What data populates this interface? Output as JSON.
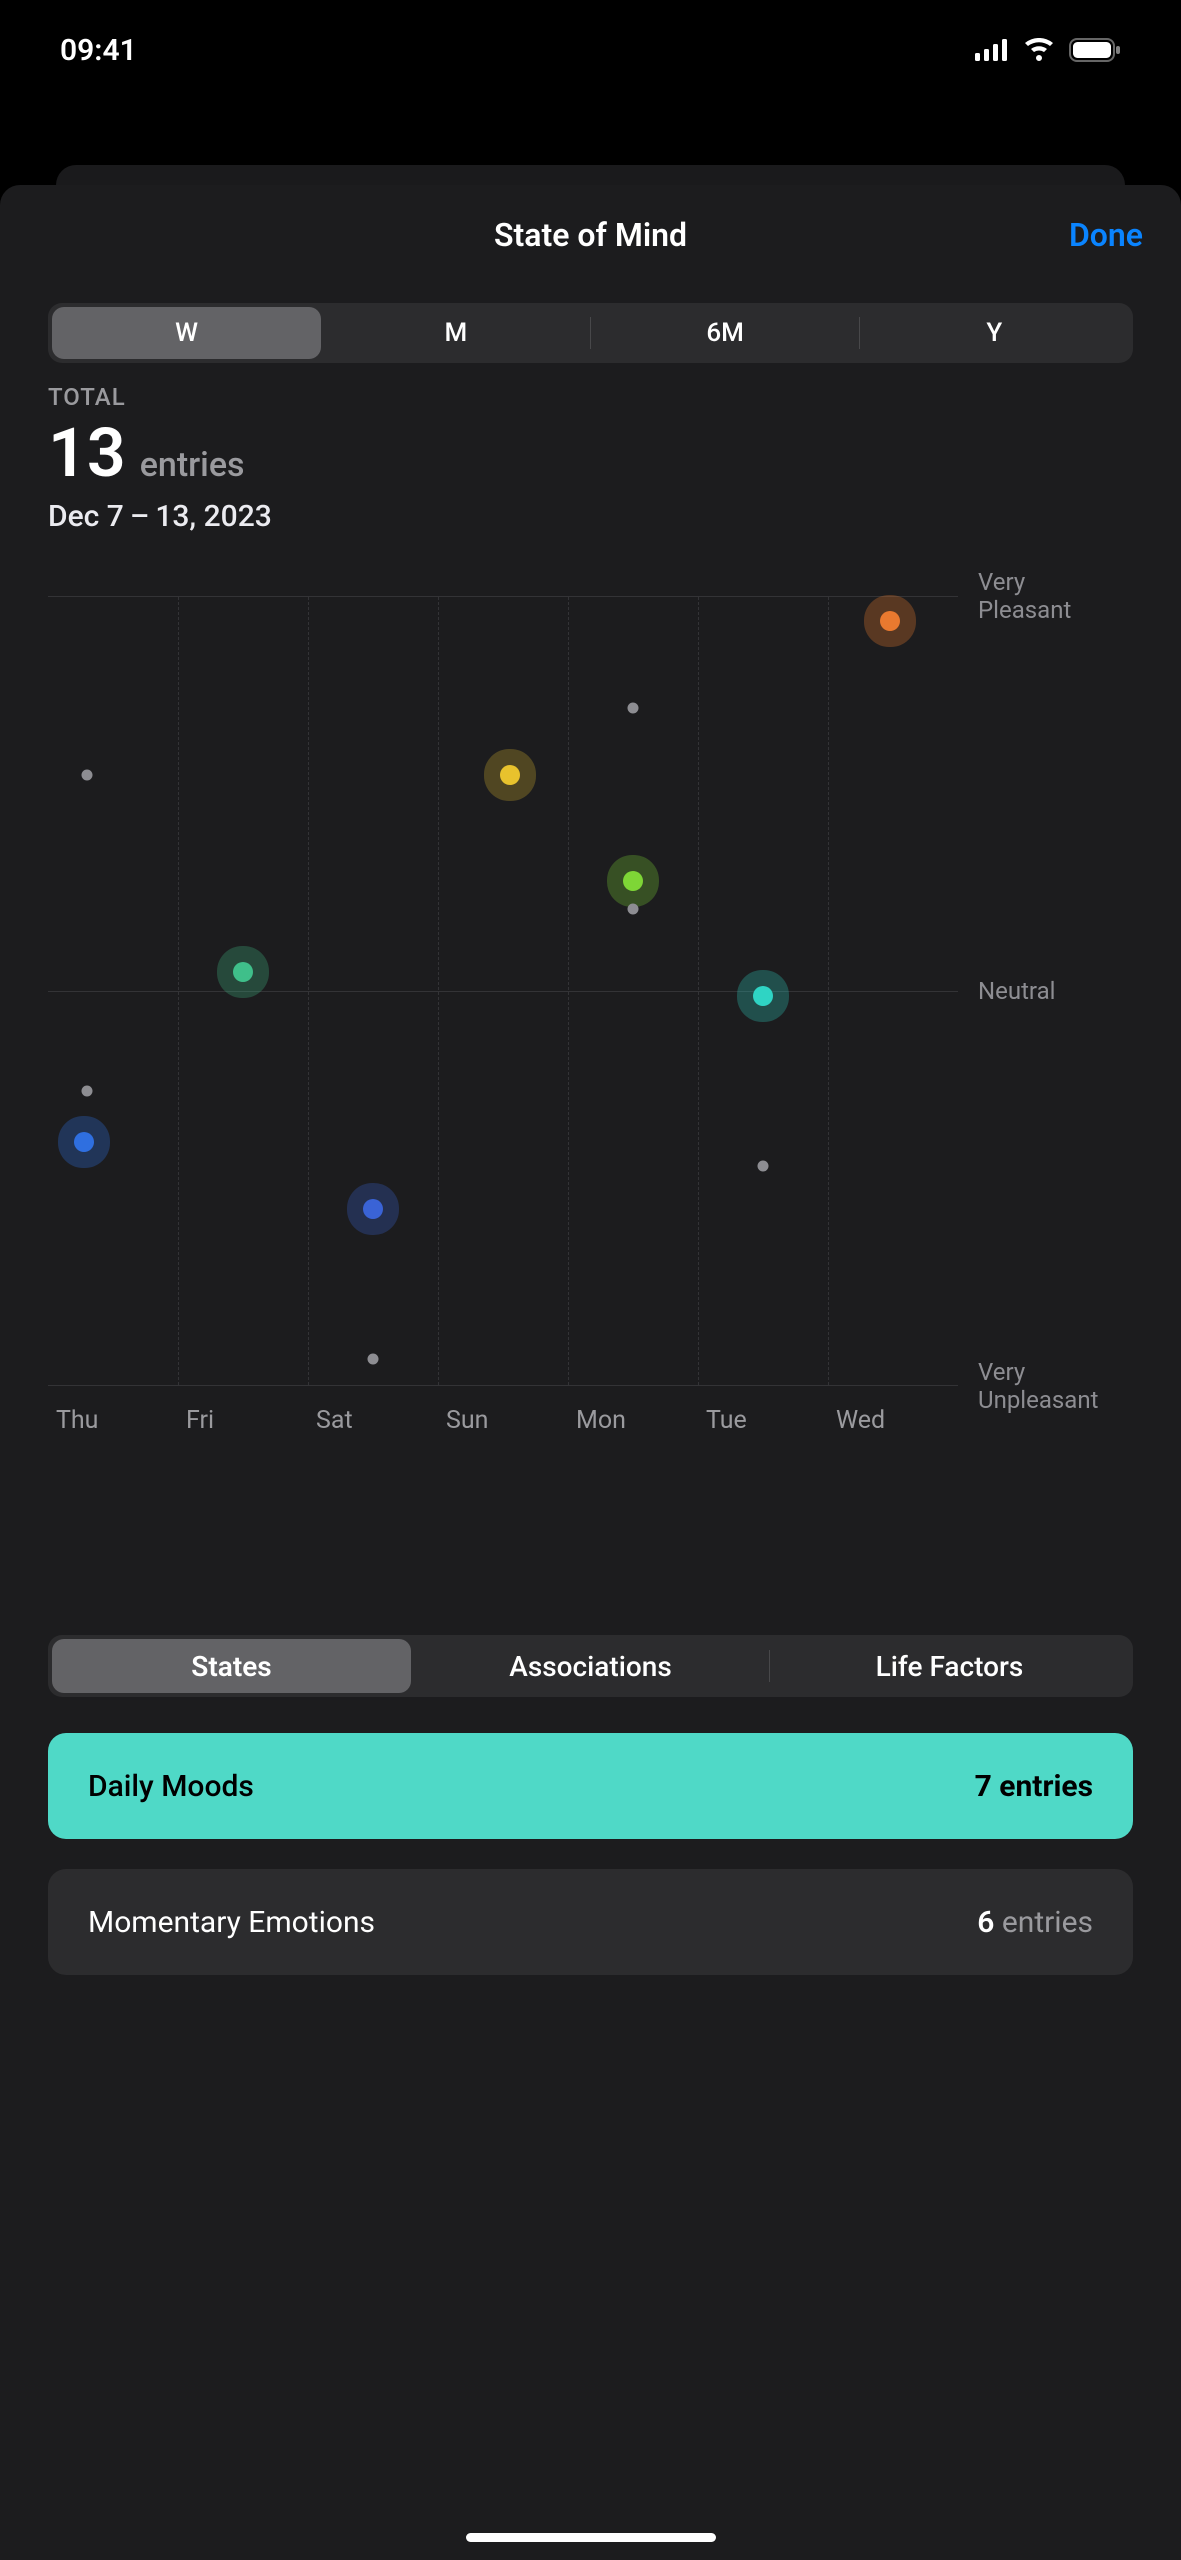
{
  "status_bar": {
    "time": "09:41"
  },
  "header": {
    "title": "State of Mind",
    "done": "Done"
  },
  "range_tabs": [
    "W",
    "M",
    "6M",
    "Y"
  ],
  "range_selected": 0,
  "summary": {
    "label": "TOTAL",
    "value": "13",
    "unit": "entries",
    "date_range": "Dec 7 – 13, 2023"
  },
  "detail_tabs": [
    "States",
    "Associations",
    "Life Factors"
  ],
  "detail_selected": 0,
  "categories": [
    {
      "label": "Daily Moods",
      "count": "7",
      "unit": "entries",
      "active": true
    },
    {
      "label": "Momentary Emotions",
      "count": "6",
      "unit": "entries",
      "active": false
    }
  ],
  "chart_data": {
    "type": "scatter",
    "xlabel": "",
    "ylabel": "",
    "y_scale_note": "value range -1 (Very Unpleasant) … 0 (Neutral) … 1 (Very Pleasant)",
    "categories": [
      "Thu",
      "Fri",
      "Sat",
      "Sun",
      "Mon",
      "Tue",
      "Wed"
    ],
    "x_day_offset_note": "x-offset 0=left edge of day column, 1=right edge",
    "y_axis_labels": [
      {
        "text": "Very Pleasant",
        "value": 1
      },
      {
        "text": "Neutral",
        "value": 0
      },
      {
        "text": "Very Unpleasant",
        "value": -1
      }
    ],
    "series": [
      {
        "name": "Daily Moods",
        "kind": "major",
        "points": [
          {
            "day": "Thu",
            "x_offset": 0.28,
            "value": -0.38,
            "color": "#2f6fe0",
            "halo": "rgba(47,111,224,0.30)"
          },
          {
            "day": "Fri",
            "x_offset": 0.5,
            "value": 0.05,
            "color": "#3fbf8a",
            "halo": "rgba(63,191,138,0.28)"
          },
          {
            "day": "Sat",
            "x_offset": 0.5,
            "value": -0.55,
            "color": "#3a63d6",
            "halo": "rgba(58,99,214,0.28)"
          },
          {
            "day": "Sun",
            "x_offset": 0.55,
            "value": 0.55,
            "color": "#e8c22d",
            "halo": "rgba(232,194,45,0.26)"
          },
          {
            "day": "Mon",
            "x_offset": 0.5,
            "value": 0.28,
            "color": "#7ed636",
            "halo": "rgba(126,214,54,0.28)"
          },
          {
            "day": "Tue",
            "x_offset": 0.5,
            "value": -0.01,
            "color": "#2fd4c4",
            "halo": "rgba(47,212,196,0.28)"
          },
          {
            "day": "Wed",
            "x_offset": 0.48,
            "value": 0.94,
            "color": "#e9792f",
            "halo": "rgba(233,121,47,0.30)"
          }
        ]
      },
      {
        "name": "Momentary Emotions",
        "kind": "minor",
        "points": [
          {
            "day": "Thu",
            "x_offset": 0.3,
            "value": 0.55
          },
          {
            "day": "Thu",
            "x_offset": 0.3,
            "value": -0.25
          },
          {
            "day": "Sat",
            "x_offset": 0.5,
            "value": -0.93
          },
          {
            "day": "Mon",
            "x_offset": 0.5,
            "value": 0.72
          },
          {
            "day": "Mon",
            "x_offset": 0.5,
            "value": 0.21
          },
          {
            "day": "Tue",
            "x_offset": 0.5,
            "value": -0.44
          }
        ]
      }
    ]
  }
}
